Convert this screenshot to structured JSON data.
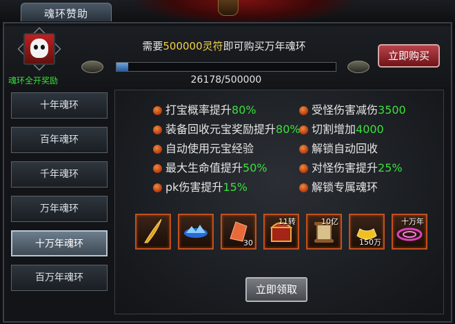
{
  "window": {
    "title": "魂环赞助"
  },
  "header": {
    "award_label": "魂环全开奖励",
    "need_prefix": "需要",
    "need_amount": "500000灵符",
    "need_suffix": "即可购买万年魂环",
    "progress_text": "26178/500000",
    "progress_fraction": 0.052,
    "buy_label": "立即购买"
  },
  "tabs": [
    {
      "label": "十年魂环"
    },
    {
      "label": "百年魂环"
    },
    {
      "label": "千年魂环"
    },
    {
      "label": "万年魂环"
    },
    {
      "label": "十万年魂环",
      "active": true
    },
    {
      "label": "百万年魂环"
    }
  ],
  "benefits_left": [
    {
      "text": "打宝概率提升",
      "value": "80%"
    },
    {
      "text": "装备回收元宝奖励提升",
      "value": "80%"
    },
    {
      "text": "自动使用元宝经验",
      "value": ""
    },
    {
      "text": "最大生命值提升",
      "value": "50%"
    },
    {
      "text": "pk伤害提升",
      "value": "15%"
    }
  ],
  "benefits_right": [
    {
      "text": "受怪伤害减伤",
      "value": "3500"
    },
    {
      "text": "切割增加",
      "value": "4000"
    },
    {
      "text": "解锁自动回收",
      "value": ""
    },
    {
      "text": "对怪伤害提升",
      "value": "25%"
    },
    {
      "text": "解锁专属魂环",
      "value": ""
    }
  ],
  "rewards": [
    {
      "icon": "golden-feather-icon",
      "count": "",
      "tag": ""
    },
    {
      "icon": "blue-crystal-icon",
      "count": "",
      "tag": ""
    },
    {
      "icon": "fire-stone-icon",
      "count": "30",
      "tag": ""
    },
    {
      "icon": "treasure-chest-icon",
      "count": "",
      "tag": "11转"
    },
    {
      "icon": "scroll-icon",
      "count": "",
      "tag": "10亿"
    },
    {
      "icon": "gold-ingot-icon",
      "count": "150万",
      "tag": ""
    },
    {
      "icon": "soul-ring-icon",
      "count": "",
      "tag": "十万年"
    }
  ],
  "claim_label": "立即领取",
  "colors": {
    "highlight": "#3ce03c",
    "amount": "#f0d24a",
    "buy": "#b8424a"
  }
}
